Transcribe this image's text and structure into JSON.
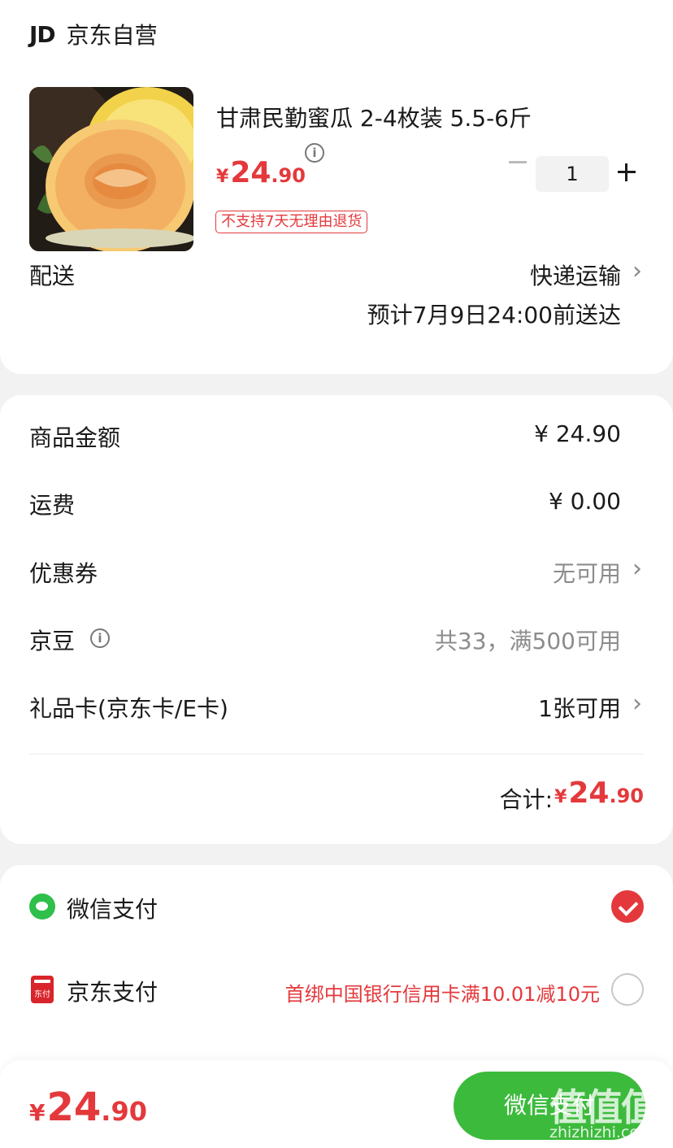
{
  "shop": {
    "logo": "JD",
    "name": "京东自营"
  },
  "product": {
    "title": "甘肃民勤蜜瓜 2-4枚装 5.5-6斤",
    "price_symbol": "¥",
    "price_int": "24",
    "price_dec": ".90",
    "return_tag": "不支持7天无理由退货",
    "quantity": "1",
    "image_icon": "melon-image"
  },
  "delivery": {
    "label": "配送",
    "method": "快递运输",
    "eta": "预计7月9日24:00前送达"
  },
  "fees": {
    "items": [
      {
        "label": "商品金额",
        "value": "¥ 24.90"
      },
      {
        "label": "运费",
        "value": "¥ 0.00"
      },
      {
        "label": "优惠券",
        "value": "无可用"
      },
      {
        "label": "京豆",
        "value": "共33，满500可用"
      },
      {
        "label": "礼品卡(京东卡/E卡)",
        "value": "1张可用"
      }
    ],
    "total_label": "合计:",
    "total_symbol": "¥",
    "total_int": "24",
    "total_dec": ".90"
  },
  "payment": {
    "options": [
      {
        "label": "微信支付",
        "promo": "",
        "selected": true,
        "icon": "wechat-pay-icon"
      },
      {
        "label": "京东支付",
        "promo": "首绑中国银行信用卡满10.01减10元",
        "selected": false,
        "icon": "jd-pay-icon"
      }
    ],
    "jdpay_icon_text": "东付"
  },
  "bottom": {
    "price_symbol": "¥",
    "price_int": "24",
    "price_dec": ".90",
    "button_label": "微信支付"
  },
  "watermark": {
    "main": "值值值",
    "sub": "zhizhizhi.com"
  },
  "colors": {
    "accent": "#e4393c",
    "wechat_green": "#3cba3c"
  }
}
